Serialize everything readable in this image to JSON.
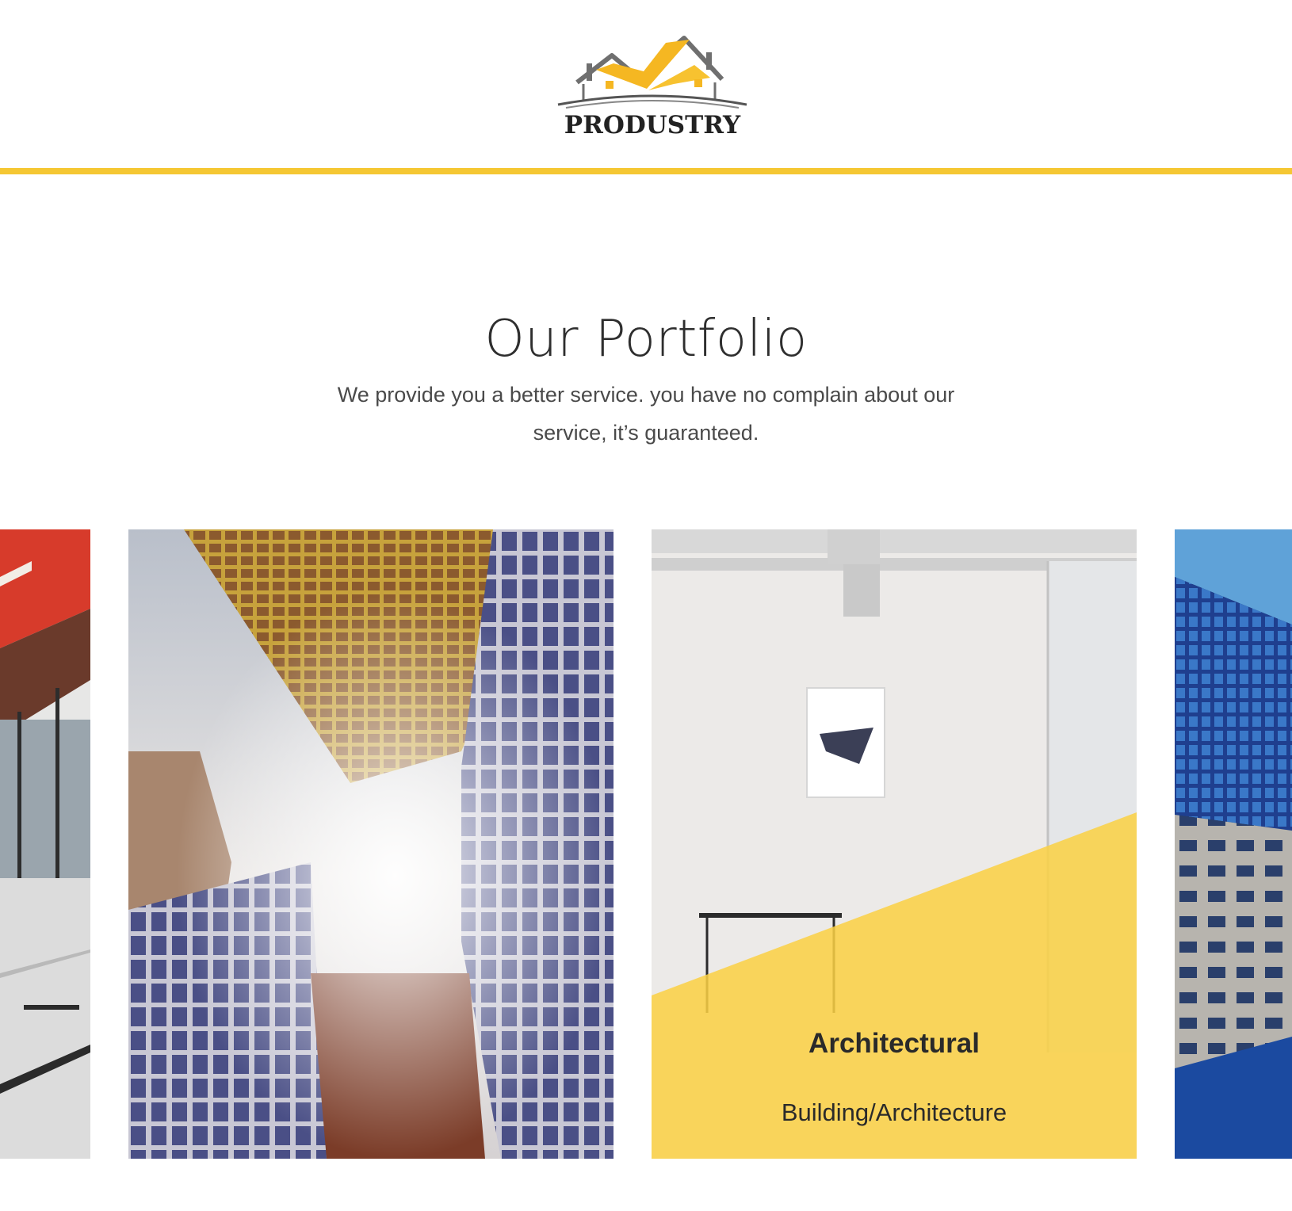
{
  "brand": {
    "name": "PRODUSTRY",
    "logo_icon": "house-roof-logo-icon",
    "accent_color": "#f5c733"
  },
  "portfolio": {
    "title": "Our Portfolio",
    "subtitle": "We provide you a better service. you have no complain about our service, it’s guaranteed.",
    "items": [
      {
        "image": "red-ceiling-glass-lobby-photo"
      },
      {
        "image": "skyscrapers-from-below-photo"
      },
      {
        "image": "white-interior-yellow-sofa-photo",
        "title": "Architectural",
        "category": "Building/Architecture",
        "active": true
      },
      {
        "image": "blue-glass-tower-photo"
      }
    ]
  }
}
